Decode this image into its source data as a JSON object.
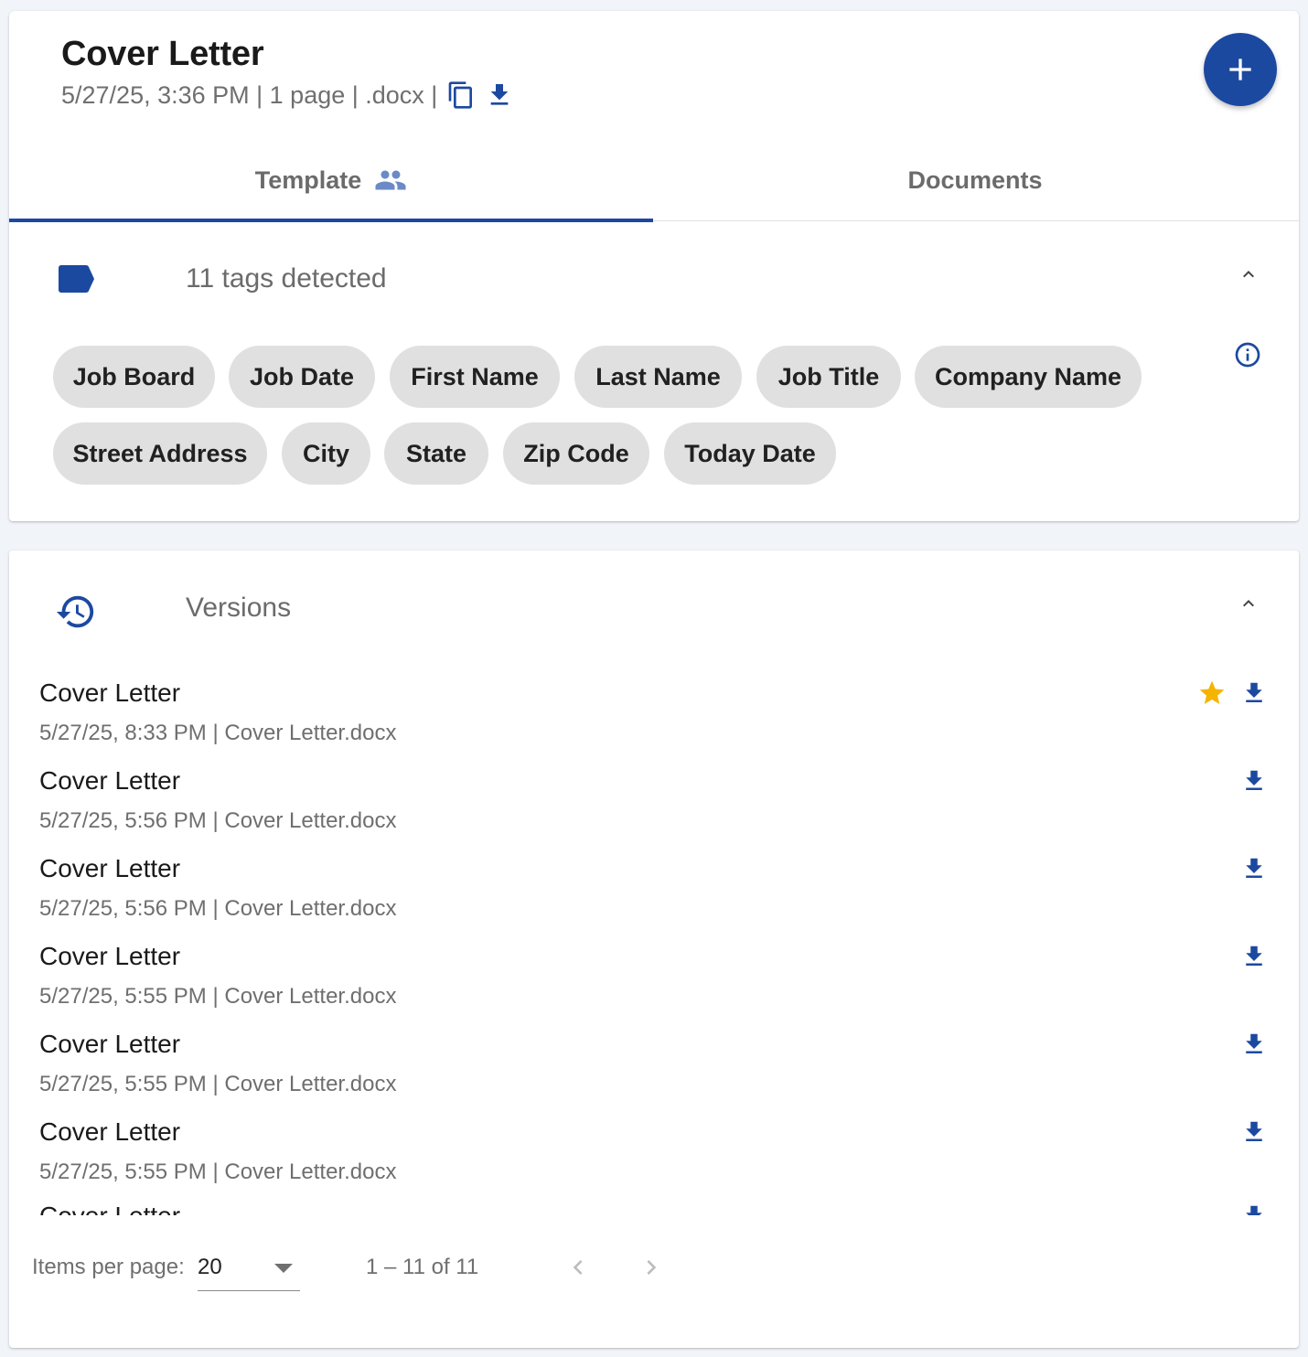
{
  "header": {
    "title": "Cover Letter",
    "meta": "5/27/25, 3:36 PM | 1 page | .docx |",
    "copy_icon": "copy-icon",
    "download_icon": "download-icon",
    "fab_icon": "plus-icon"
  },
  "tabs": [
    {
      "label": "Template",
      "icon": "people-icon",
      "active": true
    },
    {
      "label": "Documents",
      "active": false
    }
  ],
  "tags_section": {
    "icon": "label-icon",
    "title": "11 tags detected",
    "info_icon": "info-icon",
    "tags": [
      "Job Board",
      "Job Date",
      "First Name",
      "Last Name",
      "Job Title",
      "Company Name",
      "Street Address",
      "City",
      "State",
      "Zip Code",
      "Today Date"
    ]
  },
  "versions_section": {
    "icon": "history-icon",
    "title": "Versions",
    "items": [
      {
        "name": "Cover Letter",
        "meta": "5/27/25, 8:33 PM | Cover Letter.docx",
        "starred": true
      },
      {
        "name": "Cover Letter",
        "meta": "5/27/25, 5:56 PM | Cover Letter.docx",
        "starred": false
      },
      {
        "name": "Cover Letter",
        "meta": "5/27/25, 5:56 PM | Cover Letter.docx",
        "starred": false
      },
      {
        "name": "Cover Letter",
        "meta": "5/27/25, 5:55 PM | Cover Letter.docx",
        "starred": false
      },
      {
        "name": "Cover Letter",
        "meta": "5/27/25, 5:55 PM | Cover Letter.docx",
        "starred": false
      },
      {
        "name": "Cover Letter",
        "meta": "5/27/25, 5:55 PM | Cover Letter.docx",
        "starred": false
      },
      {
        "name": "Cover Letter",
        "meta": "",
        "starred": false
      }
    ]
  },
  "paginator": {
    "items_per_page_label": "Items per page:",
    "items_per_page_value": "20",
    "range": "1 – 11 of 11"
  },
  "colors": {
    "primary": "#1c49a0",
    "star": "#f4b400",
    "chip_bg": "#e0e0e0"
  }
}
